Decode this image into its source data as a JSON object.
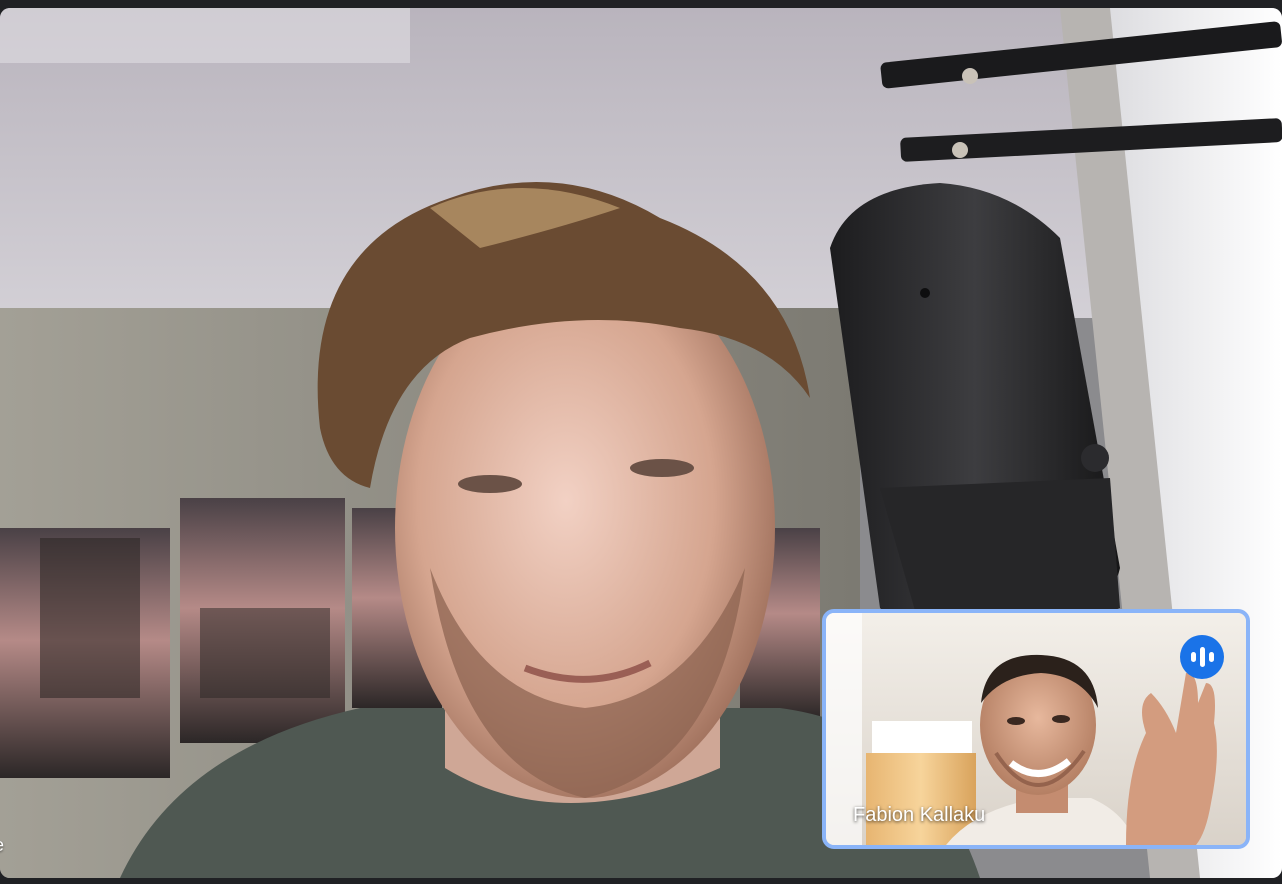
{
  "meeting": {
    "main_participant": {
      "name_fragment": "e",
      "icon": "camera-feed"
    },
    "pip_participant": {
      "name": "Fabion Kallaku",
      "speaking_icon": "audio-level-icon"
    }
  },
  "colors": {
    "background": "#202124",
    "pip_border": "#8ab4f8",
    "speaking_badge": "#1a73e8"
  }
}
